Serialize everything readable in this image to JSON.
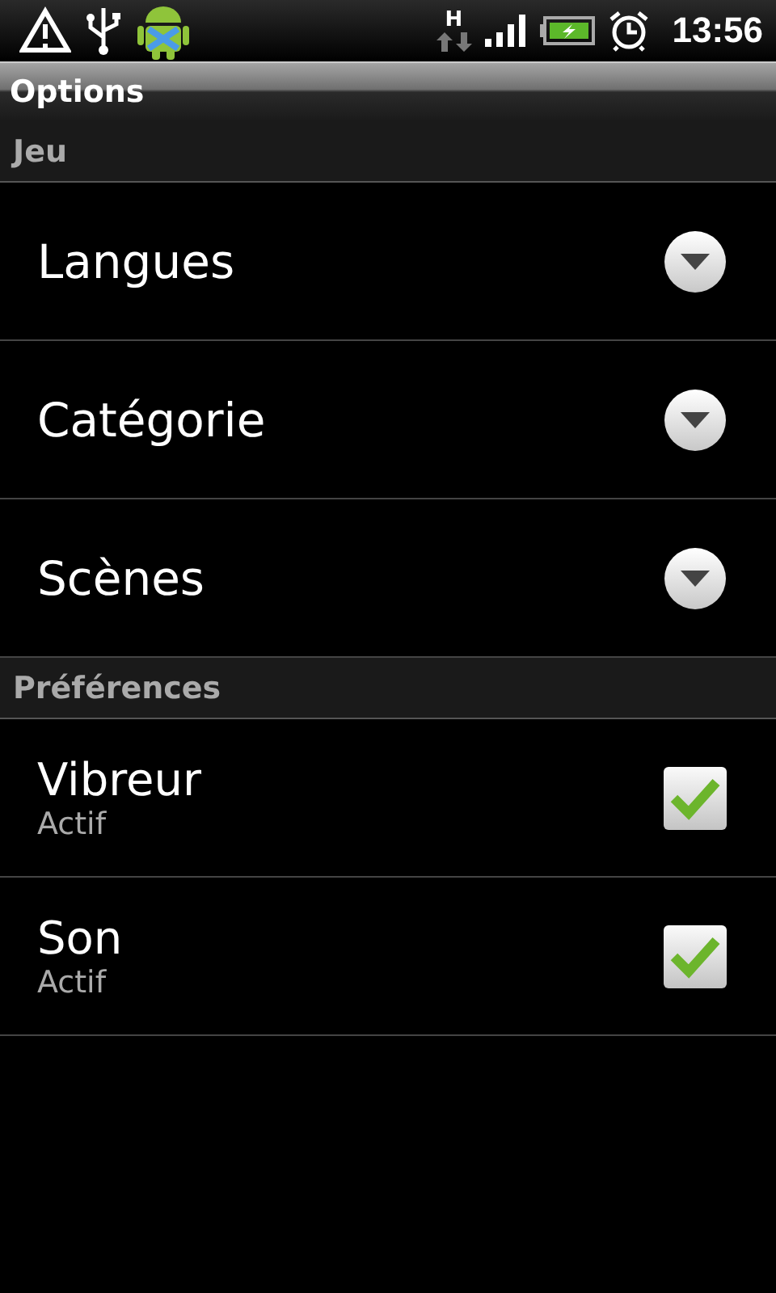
{
  "status_bar": {
    "network_type": "H",
    "time": "13:56"
  },
  "title_bar": {
    "title": "Options"
  },
  "sections": [
    {
      "header": "Jeu",
      "items": [
        {
          "kind": "dropdown",
          "label": "Langues"
        },
        {
          "kind": "dropdown",
          "label": "Catégorie"
        },
        {
          "kind": "dropdown",
          "label": "Scènes"
        }
      ]
    },
    {
      "header": "Préférences",
      "items": [
        {
          "kind": "checkbox",
          "label": "Vibreur",
          "summary": "Actif",
          "checked": true
        },
        {
          "kind": "checkbox",
          "label": "Son",
          "summary": "Actif",
          "checked": true
        }
      ]
    }
  ]
}
